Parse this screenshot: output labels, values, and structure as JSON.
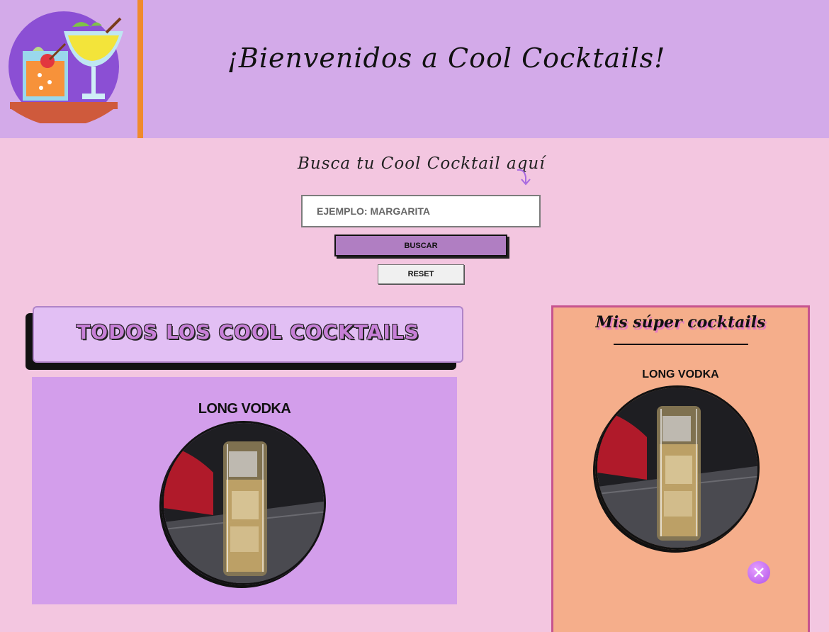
{
  "header": {
    "title": "¡Bienvenidos a Cool Cocktails!",
    "logo_icon": "cocktails-logo-icon"
  },
  "search": {
    "prompt": "Busca tu Cool Cocktail aquí",
    "placeholder": "EJEMPLO: MARGARITA",
    "value": "",
    "search_button": "BUSCAR",
    "reset_button": "RESET"
  },
  "all_cocktails": {
    "title": "TODOS LOS COOL COCKTAILS",
    "items": [
      {
        "name": "LONG VODKA"
      }
    ]
  },
  "favorites": {
    "title": "Mis súper cocktails",
    "items": [
      {
        "name": "LONG VODKA"
      }
    ]
  },
  "colors": {
    "header_bg": "#d3aae9",
    "page_bg": "#f3c6e0",
    "accent_bar": "#f08a2c",
    "favorites_bg": "#f5ae8b",
    "favorites_border": "#c6538f",
    "card_bg": "#d39eeb"
  }
}
